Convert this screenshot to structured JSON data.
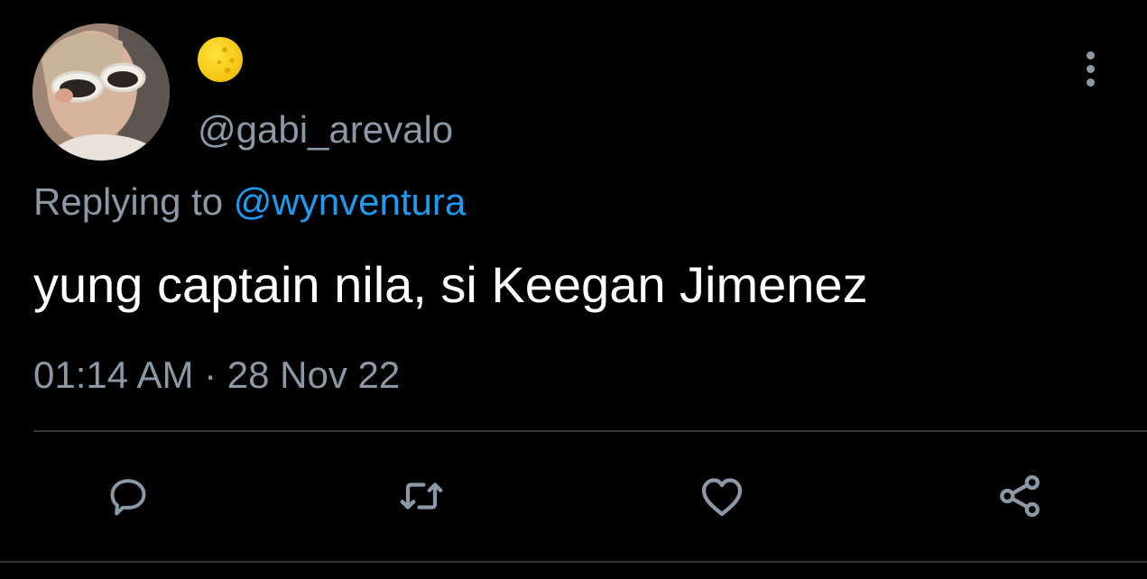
{
  "tweet": {
    "display_name_emoji": "moon-emoji",
    "handle": "@gabi_arevalo",
    "reply_prefix": "Replying to ",
    "reply_mention": "@wynventura",
    "text": "yung captain nila, si Keegan Jimenez",
    "time": "01:14 AM",
    "separator": " · ",
    "date": "28 Nov 22"
  },
  "actions": [
    {
      "name": "reply",
      "icon": "speech-bubble-icon"
    },
    {
      "name": "retweet",
      "icon": "retweet-icon"
    },
    {
      "name": "like",
      "icon": "heart-icon"
    },
    {
      "name": "share",
      "icon": "share-nodes-icon"
    }
  ],
  "colors": {
    "background": "#000000",
    "text_primary": "#ffffff",
    "text_secondary": "#8b98a5",
    "link": "#1d9bf0",
    "divider": "#2f3336",
    "emoji": "#f2c40f"
  }
}
